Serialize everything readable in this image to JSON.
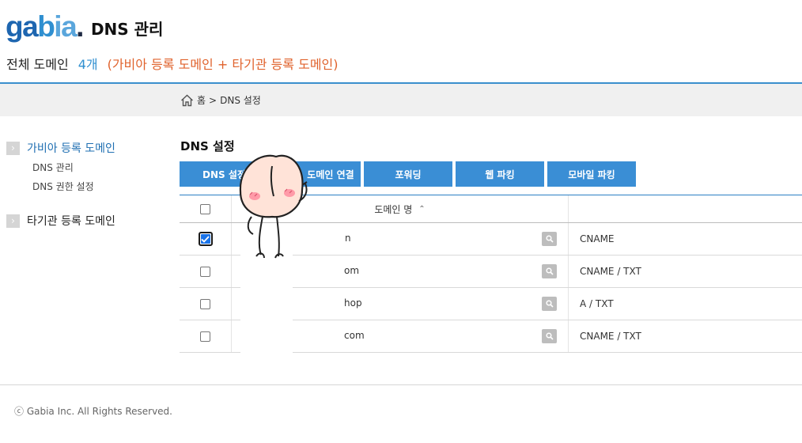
{
  "header": {
    "logo_text": "gabia.",
    "app_title": "DNS 관리",
    "summary_label": "전체 도메인",
    "summary_count": "4개",
    "summary_note": "(가비아 등록 도메인 + 타기관 등록 도메인)"
  },
  "breadcrumb": {
    "home_label": "홈",
    "separator": ">",
    "current": "DNS 설정"
  },
  "sidebar": {
    "sections": [
      {
        "label": "가비아 등록 도메인",
        "active": true,
        "items": [
          "DNS 관리",
          "DNS 권한 설정"
        ]
      },
      {
        "label": "타기관 등록 도메인",
        "active": false,
        "items": []
      }
    ]
  },
  "main": {
    "title": "DNS 설정",
    "tabs": [
      "DNS 설정",
      "도메인 연결",
      "포워딩",
      "웹 파킹",
      "모바일 파킹"
    ],
    "table": {
      "column_domain": "도메인 명",
      "sort_indicator": "^",
      "rows": [
        {
          "domain_suffix": "n",
          "record": "CNAME",
          "checked": true
        },
        {
          "domain_suffix": "om",
          "record": "CNAME / TXT",
          "checked": false
        },
        {
          "domain_suffix": "hop",
          "record": "A / TXT",
          "checked": false
        },
        {
          "domain_suffix": "com",
          "record": "CNAME / TXT",
          "checked": false
        }
      ]
    }
  },
  "footer": {
    "copyright": "ⓒ Gabia Inc. All Rights Reserved."
  },
  "colors": {
    "accent": "#3a8ed5",
    "active_nav": "#1f6fb2",
    "note_orange": "#e0622c",
    "count_blue": "#2f8fd0"
  },
  "icons": {
    "home": "home-icon",
    "search": "search-icon",
    "chevron": "chevron-right-icon",
    "sort": "sort-up-icon",
    "sticker": "peach-character-sticker"
  }
}
